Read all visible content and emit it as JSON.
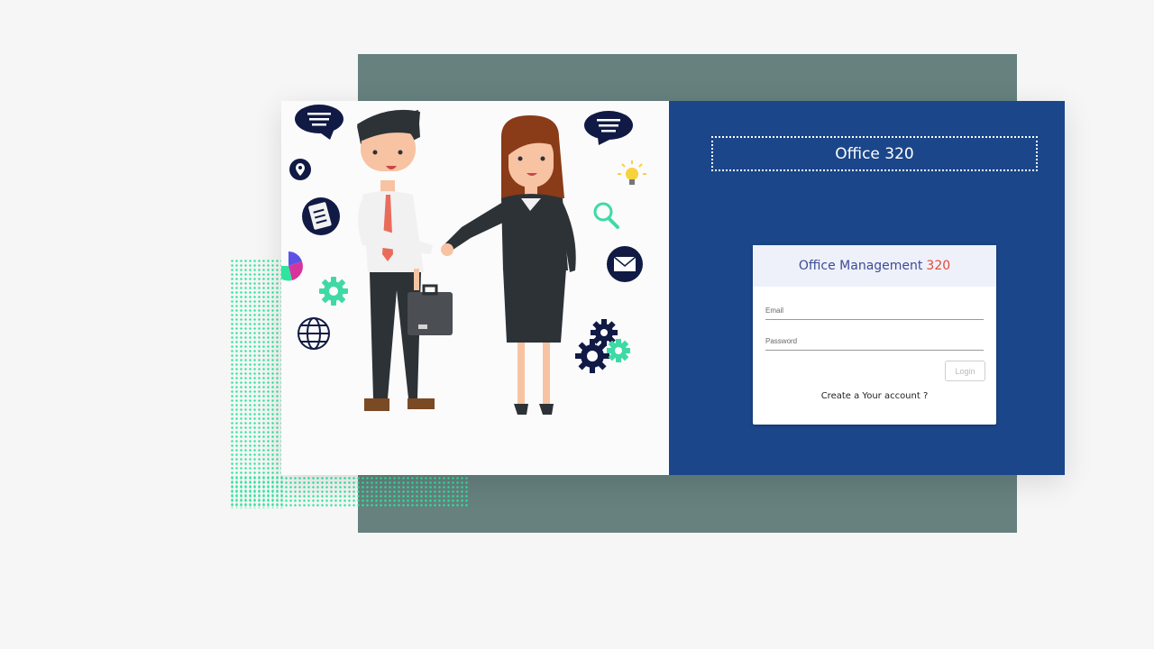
{
  "brand": {
    "title": "Office 320"
  },
  "login": {
    "heading_main": "Office Management",
    "heading_number": "320",
    "email_label": "Email",
    "password_label": "Password",
    "login_button": "Login",
    "create_account_link": "Create a Your account ?"
  },
  "colors": {
    "page_background": "#f6f6f6",
    "back_slab": "#66817e",
    "panel": "#1b468a",
    "dots": "#2ee59d",
    "heading_main": "#3d4c95",
    "heading_number": "#e24a3b"
  },
  "illustration": {
    "icons": [
      "speech-bubble-icon",
      "location-pin-icon",
      "clipboard-icon",
      "pie-chart-icon",
      "gear-icon",
      "globe-icon",
      "lightbulb-icon",
      "magnifier-icon",
      "envelope-icon",
      "gears-icon"
    ]
  }
}
